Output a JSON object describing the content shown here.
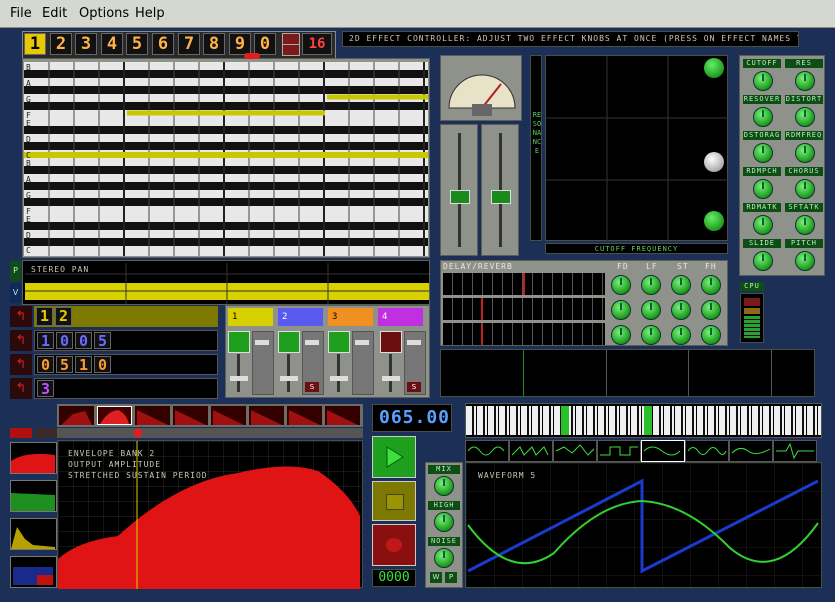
{
  "menu": [
    "File",
    "Edit",
    "Options",
    "Help"
  ],
  "pattern_buttons": [
    "1",
    "2",
    "3",
    "4",
    "5",
    "6",
    "7",
    "8",
    "9",
    "0"
  ],
  "pattern_count": "16",
  "effect_help": "2D EFFECT CONTROLLER:  ADJUST TWO EFFECT KNOBS AT ONCE  (PRESS ON EFFECT NAMES TO SWITCH)",
  "note_labels_upper": [
    "B",
    "A",
    "G",
    "F",
    "E",
    "D",
    "C"
  ],
  "note_labels_lower": [
    "B",
    "A",
    "G",
    "F",
    "E",
    "D",
    "C"
  ],
  "stereo_pan_label": "STEREO PAN",
  "side_toggles": [
    "P",
    "V"
  ],
  "xy_axis_y": "RESONANCE",
  "xy_axis_x": "CUTOFF FREQUENCY",
  "effect_knobs": [
    "CUTOFF",
    "RES",
    "RESOVER",
    "DISTORT",
    "DSTORAG",
    "RDMFREQ",
    "RDMPCH",
    "CHORUS",
    "RDMATK",
    "SFTATK",
    "SLIDE",
    "PITCH"
  ],
  "cpu_label": "CPU",
  "delay": {
    "title": "DELAY/REVERB",
    "cols": [
      "FD",
      "LF",
      "ST",
      "FH"
    ]
  },
  "sequence_rows": [
    {
      "digits": [
        "1",
        "2"
      ],
      "color": "#e8c800"
    },
    {
      "digits": [
        "1",
        "0",
        "0",
        "5"
      ],
      "color": "#6b6bff"
    },
    {
      "digits": [
        "0",
        "5",
        "1",
        "0"
      ],
      "color": "#ff9a30"
    },
    {
      "digits": [
        "3"
      ],
      "color": "#c050ff"
    }
  ],
  "channels": [
    {
      "label": "1",
      "color": "#d8d000",
      "text": "#000"
    },
    {
      "label": "2",
      "color": "#5a5af0",
      "text": "#fff"
    },
    {
      "label": "3",
      "color": "#f09020",
      "text": "#000"
    },
    {
      "label": "4",
      "color": "#c030e0",
      "text": "#fff"
    }
  ],
  "solo_label": "S",
  "tempo": "065.00",
  "envelope_text": [
    "ENVELOPE BANK 2",
    "OUTPUT AMPLITUDE",
    "STRETCHED SUSTAIN PERIOD"
  ],
  "waveform_title": "WAVEFORM 5",
  "mix_labels": [
    "MIX",
    "HIGH",
    "NOISE"
  ],
  "mix_buttons": [
    "W",
    "P"
  ],
  "counter": "0000"
}
